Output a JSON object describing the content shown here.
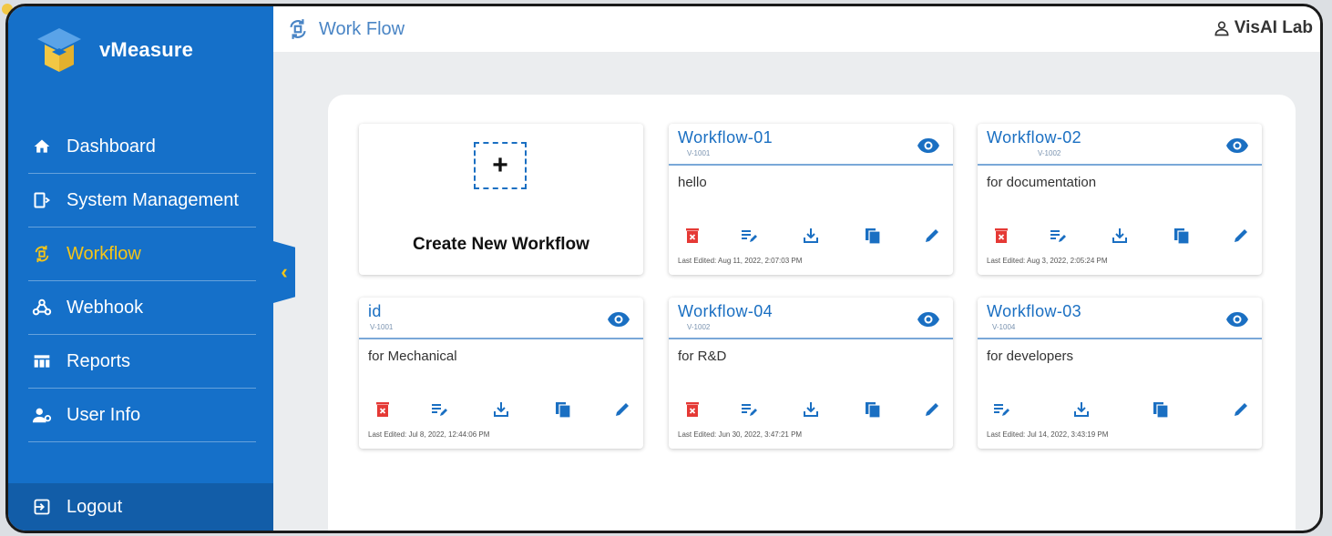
{
  "app": {
    "name": "vMeasure"
  },
  "sidebar": {
    "items": [
      {
        "label": "Dashboard",
        "icon": "home-icon"
      },
      {
        "label": "System Management",
        "icon": "system-management-icon"
      },
      {
        "label": "Workflow",
        "icon": "workflow-icon",
        "active": true
      },
      {
        "label": "Webhook",
        "icon": "webhook-icon"
      },
      {
        "label": "Reports",
        "icon": "reports-icon"
      },
      {
        "label": "User Info",
        "icon": "user-info-icon"
      }
    ],
    "logout_label": "Logout"
  },
  "header": {
    "title": "Work Flow",
    "user": "VisAI Lab"
  },
  "create_card": {
    "label": "Create New Workflow",
    "plus": "+"
  },
  "workflows": [
    {
      "title": "Workflow-01",
      "version": "V-1001",
      "description": "hello",
      "last_edited": "Last Edited: Aug 11, 2022, 2:07:03 PM",
      "has_delete": true
    },
    {
      "title": "Workflow-02",
      "version": "V-1002",
      "description": "for documentation",
      "last_edited": "Last Edited: Aug 3, 2022, 2:05:24 PM",
      "has_delete": true
    },
    {
      "title": "id",
      "version": "V-1001",
      "description": "for Mechanical",
      "last_edited": "Last Edited: Jul 8, 2022, 12:44:06 PM",
      "has_delete": true
    },
    {
      "title": "Workflow-04",
      "version": "V-1002",
      "description": "for R&D",
      "last_edited": "Last Edited: Jun 30, 2022, 3:47:21 PM",
      "has_delete": true
    },
    {
      "title": "Workflow-03",
      "version": "V-1004",
      "description": "for developers",
      "last_edited": "Last Edited: Jul 14, 2022, 3:43:19 PM",
      "has_delete": false
    }
  ],
  "colors": {
    "sidebar": "#1570c9",
    "active": "#f5c518",
    "accent": "#1a6fc2",
    "delete": "#e53935"
  }
}
